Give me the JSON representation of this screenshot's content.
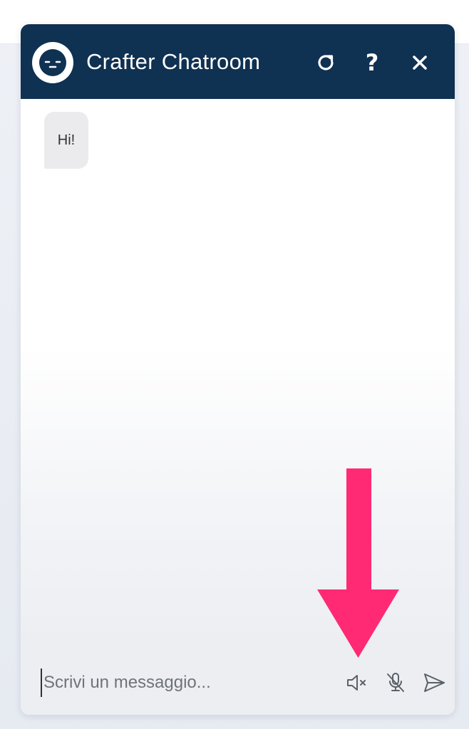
{
  "chat": {
    "title": "Crafter Chatroom",
    "messages": [
      {
        "text": "Hi!"
      }
    ],
    "input_placeholder": "Scrivi un messaggio..."
  },
  "icons": {
    "avatar": "bot-face-icon",
    "refresh": "refresh-icon",
    "help": "help-icon",
    "close": "close-icon",
    "mute": "speaker-muted-icon",
    "mic": "microphone-off-icon",
    "send": "send-icon",
    "annotation": "down-arrow-icon"
  },
  "colors": {
    "header_bg": "#0f3152",
    "bubble_bg": "#ebebed",
    "annotation_arrow": "#ff2a73"
  }
}
